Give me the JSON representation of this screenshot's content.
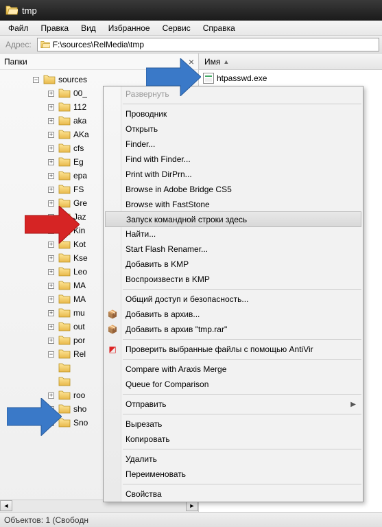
{
  "window": {
    "title": "tmp"
  },
  "menu": {
    "file": "Файл",
    "edit": "Правка",
    "view": "Вид",
    "favorites": "Избранное",
    "tools": "Сервис",
    "help": "Справка"
  },
  "address": {
    "label": "Адрес:",
    "path": "F:\\sources\\RelMedia\\tmp"
  },
  "tree": {
    "panel_title": "Папки",
    "root": "sources",
    "items": [
      {
        "label": "00_"
      },
      {
        "label": "112"
      },
      {
        "label": "aka"
      },
      {
        "label": "AKa"
      },
      {
        "label": "cfs"
      },
      {
        "label": "Eg"
      },
      {
        "label": "epa"
      },
      {
        "label": "FS "
      },
      {
        "label": "Gre"
      },
      {
        "label": "Jaz"
      },
      {
        "label": "Kin"
      },
      {
        "label": "Kot"
      },
      {
        "label": "Kse"
      },
      {
        "label": "Leo"
      },
      {
        "label": "MA"
      },
      {
        "label": "MA"
      },
      {
        "label": "mu"
      },
      {
        "label": "out"
      },
      {
        "label": "por"
      },
      {
        "label": "Rel",
        "expanded": true
      },
      {
        "label": ""
      },
      {
        "label": ""
      },
      {
        "label": "roo"
      },
      {
        "label": "sho"
      },
      {
        "label": "Sno"
      }
    ]
  },
  "list": {
    "col_name": "Имя",
    "files": [
      {
        "name": "htpasswd.exe"
      }
    ]
  },
  "context": {
    "expand": "Развернуть",
    "explorer": "Проводник",
    "open": "Открыть",
    "finder": "Finder...",
    "find_with_finder": "Find with Finder...",
    "print_dirprn": "Print with DirPrn...",
    "browse_bridge": "Browse in Adobe Bridge CS5",
    "browse_faststone": "Browse with FastStone",
    "cmd_here": "Запуск командной строки здесь",
    "find": "Найти...",
    "flash_renamer": "Start Flash Renamer...",
    "add_kmp": "Добавить в KMP",
    "play_kmp": "Воспроизвести в KMP",
    "sharing": "Общий доступ и безопасность...",
    "add_archive": "Добавить в архив...",
    "add_archive_tmp": "Добавить в архив \"tmp.rar\"",
    "antivir": "Проверить выбранные файлы с помощью AntiVir",
    "araxis_compare": "Compare with Araxis Merge",
    "araxis_queue": "Queue for Comparison",
    "send_to": "Отправить",
    "cut": "Вырезать",
    "copy": "Копировать",
    "delete": "Удалить",
    "rename": "Переименовать",
    "properties": "Свойства"
  },
  "status": {
    "text": "Объектов: 1 (Свободн"
  }
}
